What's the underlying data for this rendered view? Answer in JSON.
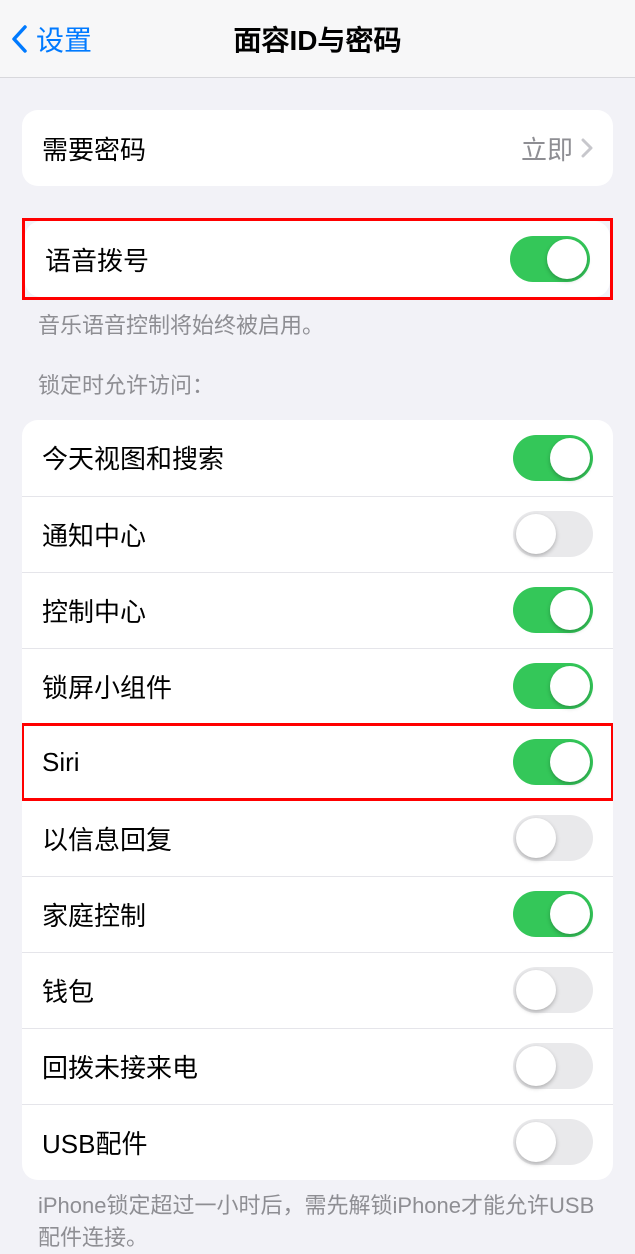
{
  "header": {
    "back_label": "设置",
    "title": "面容ID与密码"
  },
  "passcode_row": {
    "label": "需要密码",
    "value": "立即"
  },
  "voice_dial": {
    "label": "语音拨号",
    "enabled": true,
    "footer": "音乐语音控制将始终被启用。"
  },
  "lock_access": {
    "header": "锁定时允许访问：",
    "items": [
      {
        "key": "today",
        "label": "今天视图和搜索",
        "enabled": true
      },
      {
        "key": "notifications",
        "label": "通知中心",
        "enabled": false
      },
      {
        "key": "control-center",
        "label": "控制中心",
        "enabled": true
      },
      {
        "key": "widgets",
        "label": "锁屏小组件",
        "enabled": true
      },
      {
        "key": "siri",
        "label": "Siri",
        "enabled": true,
        "highlighted": true
      },
      {
        "key": "reply-message",
        "label": "以信息回复",
        "enabled": false
      },
      {
        "key": "home",
        "label": "家庭控制",
        "enabled": true
      },
      {
        "key": "wallet",
        "label": "钱包",
        "enabled": false
      },
      {
        "key": "return-calls",
        "label": "回拨未接来电",
        "enabled": false
      },
      {
        "key": "usb",
        "label": "USB配件",
        "enabled": false
      }
    ],
    "footer": "iPhone锁定超过一小时后，需先解锁iPhone才能允许USB配件连接。"
  },
  "annotations": {
    "voice_dial_highlighted": true
  }
}
